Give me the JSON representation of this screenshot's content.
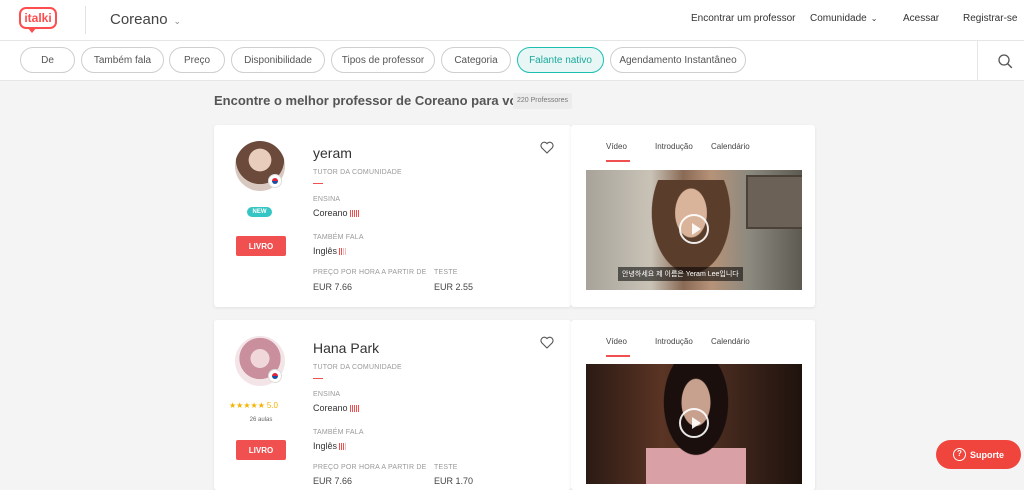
{
  "header": {
    "logo_text": "italki",
    "language": "Coreano",
    "nav": {
      "find_teacher": "Encontrar um professor",
      "community": "Comunidade",
      "login": "Acessar",
      "signup": "Registrar-se"
    }
  },
  "filters": [
    "De",
    "Também fala",
    "Preço",
    "Disponibilidade",
    "Tipos de professor",
    "Categoria",
    "Falante nativo",
    "Agendamento Instantâneo"
  ],
  "active_filter": "Falante nativo",
  "page": {
    "title": "Encontre o melhor professor de Coreano para você.",
    "count": "220 Professores"
  },
  "teachers": [
    {
      "name": "yeram",
      "type": "TUTOR DA COMUNIDADE",
      "badge": "NEW",
      "teaches_label": "ENSINA",
      "teaches": "Coreano",
      "also_label": "TAMBÉM FALA",
      "also": "Inglês",
      "price_label": "PREÇO POR HORA A PARTIR DE",
      "price": "EUR 7.66",
      "trial_label": "TESTE",
      "trial": "EUR 2.55",
      "book": "LIVRO",
      "video_caption": "안녕하세요 제 이름은 Yeram Lee입니다"
    },
    {
      "name": "Hana Park",
      "type": "TUTOR DA COMUNIDADE",
      "rating": "5.0",
      "stars": "★★★★★",
      "lessons": "26 aulas",
      "teaches_label": "ENSINA",
      "teaches": "Coreano",
      "also_label": "TAMBÉM FALA",
      "also": "Inglês",
      "price_label": "PREÇO POR HORA A PARTIR DE",
      "price": "EUR 7.66",
      "trial_label": "TESTE",
      "trial": "EUR 1.70",
      "book": "LIVRO"
    }
  ],
  "video_tabs": [
    "Vídeo",
    "Introdução",
    "Calendário"
  ],
  "support": "Suporte",
  "colors": {
    "brand": "#ff4d4d",
    "accent_teal": "#1dbfb0",
    "button_red": "#f05050"
  }
}
